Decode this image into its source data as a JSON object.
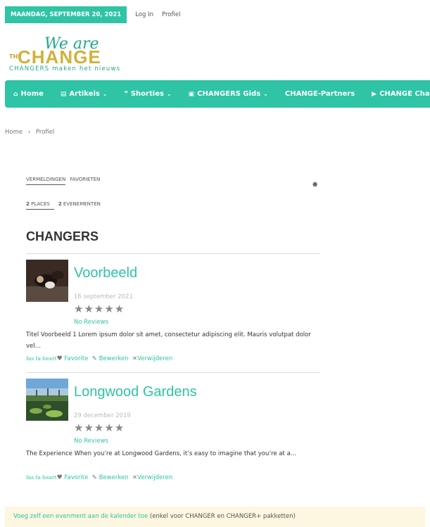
{
  "topbar": {
    "date": "MAANDAG, SEPTEMBER 20, 2021",
    "login": "Log In",
    "profile": "Profiel"
  },
  "logo": {
    "the": "THE",
    "word": "CHANGE",
    "weare": "We are",
    "tagline": "CHANGERS maken het nieuws"
  },
  "nav": {
    "items": [
      {
        "label": "Home",
        "icon": "home-icon",
        "dropdown": false
      },
      {
        "label": "Artikels",
        "icon": "newspaper-icon",
        "dropdown": true
      },
      {
        "label": "Shorties",
        "icon": "quote-icon",
        "dropdown": true
      },
      {
        "label": "CHANGERS Gids",
        "icon": "id-card-icon",
        "dropdown": true
      },
      {
        "label": "CHANGE-Partners",
        "icon": "",
        "dropdown": false
      },
      {
        "label": "CHANGE Cha",
        "icon": "youtube-icon",
        "dropdown": false
      }
    ]
  },
  "breadcrumb": {
    "home": "Home",
    "sep": "›",
    "current": "Profiel"
  },
  "tabs": {
    "mentions": "VERMELDINGEN",
    "favorites": "FAVORIETEN"
  },
  "subtabs": {
    "places_count": "2",
    "places_label": "PLACES",
    "events_count": "2",
    "events_label": "EVENEMENTEN"
  },
  "section": {
    "title": "CHANGERS"
  },
  "entries": [
    {
      "title": "Voorbeeld",
      "date": "16 september 2021",
      "stars": "★★★★★",
      "reviews": "No Reviews",
      "description": "Titel Voorbeeld 1 Lorem ipsum dolor sit amet, consectetur adipiscing elit. Mauris volutpat dolor vel…",
      "fa_text": "fas fa-heart",
      "favorite": "Favorite",
      "edit": "Bewerken",
      "delete": "Verwijderen"
    },
    {
      "title": "Longwood Gardens",
      "date": "29 december 2019",
      "stars": "★★★★★",
      "reviews": "No Reviews",
      "description": "The Experience When you’re at Longwood Gardens, it’s easy to imagine that you’re at a…",
      "fa_text": "fas fa-heart",
      "favorite": "Favorite",
      "edit": "Bewerken",
      "delete": "Verwijderen"
    }
  ],
  "notice": {
    "link": "Voeg zelf een evenment aan de kalender toe",
    "rest": " (enkel voor CHANGER en CHANGER+ pakketten)"
  },
  "colors": {
    "accent": "#2ec4a5",
    "gold": "#d4b03a",
    "notice_bg": "#fdf6e0"
  }
}
